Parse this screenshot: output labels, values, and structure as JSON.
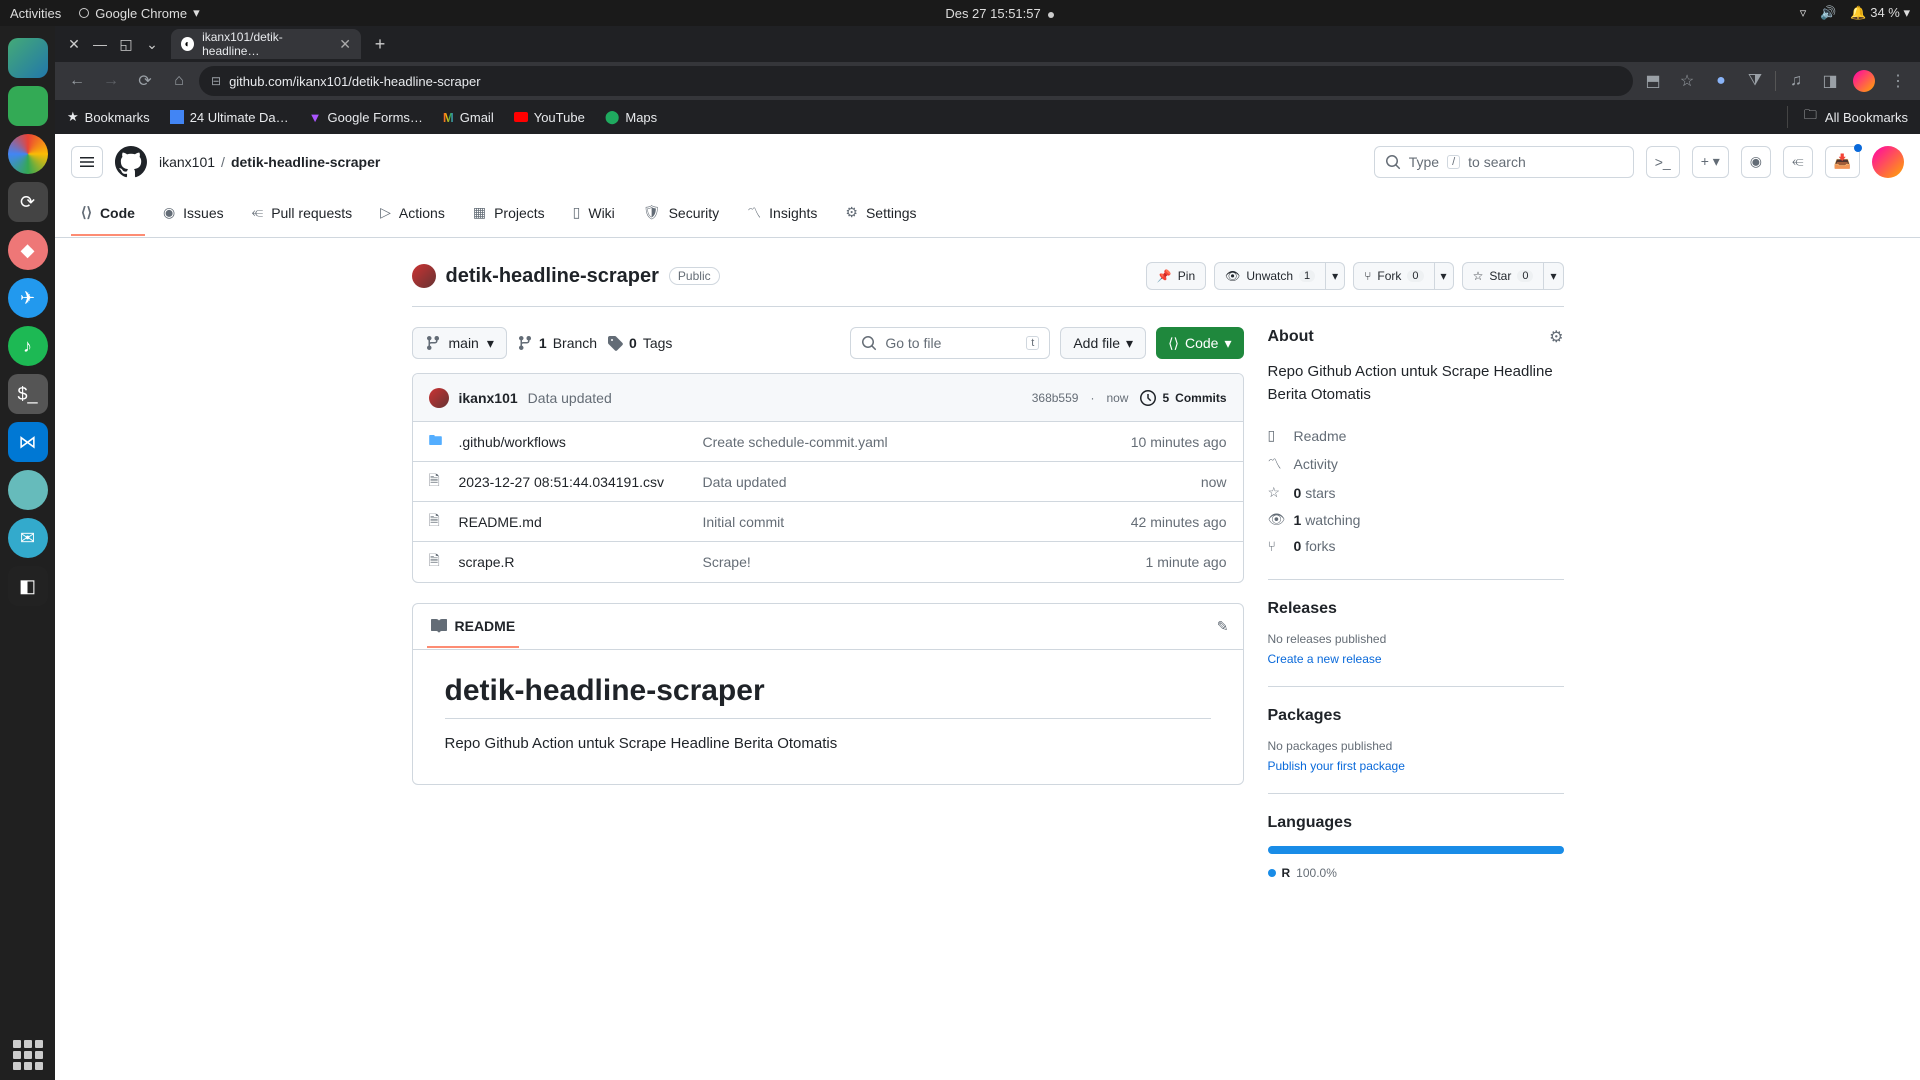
{
  "gnome": {
    "activities": "Activities",
    "app": "Google Chrome",
    "clock": "Des 27  15:51:57",
    "battery": "34 %"
  },
  "browser": {
    "tab_title": "ikanx101/detik-headline…",
    "url": "github.com/ikanx101/detik-headline-scraper",
    "bookmarks": [
      "Bookmarks",
      "24 Ultimate Da…",
      "Google Forms…",
      "Gmail",
      "YouTube",
      "Maps"
    ],
    "all_bookmarks": "All Bookmarks"
  },
  "gh": {
    "owner": "ikanx101",
    "repo": "detik-headline-scraper",
    "search_prefix": "Type",
    "search_key": "/",
    "search_suffix": "to search",
    "tabs": [
      "Code",
      "Issues",
      "Pull requests",
      "Actions",
      "Projects",
      "Wiki",
      "Security",
      "Insights",
      "Settings"
    ],
    "visibility": "Public",
    "actions": {
      "pin": "Pin",
      "unwatch": "Unwatch",
      "watch_count": "1",
      "fork": "Fork",
      "fork_count": "0",
      "star": "Star",
      "star_count": "0"
    },
    "branch": "main",
    "branches_n": "1",
    "branches_label": "Branch",
    "tags_n": "0",
    "tags_label": "Tags",
    "file_search": "Go to file",
    "file_search_key": "t",
    "add_file": "Add file",
    "code_btn": "Code",
    "commit": {
      "user": "ikanx101",
      "msg": "Data updated",
      "sha": "368b559",
      "time": "now",
      "count_n": "5",
      "count_label": "Commits"
    },
    "files": [
      {
        "type": "dir",
        "name": ".github/workflows",
        "msg": "Create schedule-commit.yaml",
        "time": "10 minutes ago"
      },
      {
        "type": "file",
        "name": "2023-12-27 08:51:44.034191.csv",
        "msg": "Data updated",
        "time": "now"
      },
      {
        "type": "file",
        "name": "README.md",
        "msg": "Initial commit",
        "time": "42 minutes ago"
      },
      {
        "type": "file",
        "name": "scrape.R",
        "msg": "Scrape!",
        "time": "1 minute ago"
      }
    ],
    "readme": {
      "tab": "README",
      "title": "detik-headline-scraper",
      "body": "Repo Github Action untuk Scrape Headline Berita Otomatis"
    },
    "about": {
      "title": "About",
      "desc": "Repo Github Action untuk Scrape Headline Berita Otomatis",
      "readme": "Readme",
      "activity": "Activity",
      "stars_n": "0",
      "stars_label": "stars",
      "watch_n": "1",
      "watch_label": "watching",
      "forks_n": "0",
      "forks_label": "forks",
      "releases_title": "Releases",
      "releases_none": "No releases published",
      "releases_link": "Create a new release",
      "packages_title": "Packages",
      "packages_none": "No packages published",
      "packages_link": "Publish your first package",
      "languages_title": "Languages",
      "lang_name": "R",
      "lang_pct": "100.0%"
    }
  }
}
